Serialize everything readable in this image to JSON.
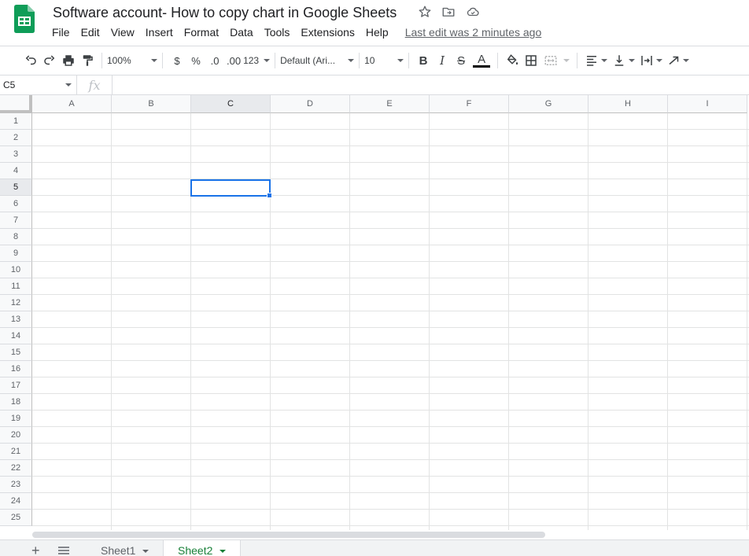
{
  "header": {
    "title": "Software account- How to copy chart in Google Sheets",
    "last_edit": "Last edit was 2 minutes ago",
    "menu": [
      "File",
      "Edit",
      "View",
      "Insert",
      "Format",
      "Data",
      "Tools",
      "Extensions",
      "Help"
    ]
  },
  "toolbar": {
    "zoom": "100%",
    "currency": "$",
    "percent": "%",
    "decrease_decimal": ".0",
    "increase_decimal": ".00",
    "more_formats": "123",
    "font": "Default (Ari...",
    "font_size": "10",
    "bold": "B",
    "italic": "I",
    "strike": "S",
    "text_color_label": "A",
    "text_color": "#000000"
  },
  "formula_bar": {
    "name_box": "C5",
    "fx": "fx",
    "value": ""
  },
  "grid": {
    "columns": [
      "A",
      "B",
      "C",
      "D",
      "E",
      "F",
      "G",
      "H",
      "I"
    ],
    "rows": [
      "1",
      "2",
      "3",
      "4",
      "5",
      "6",
      "7",
      "8",
      "9",
      "10",
      "11",
      "12",
      "13",
      "14",
      "15",
      "16",
      "17",
      "18",
      "19",
      "20",
      "21",
      "22",
      "23",
      "24",
      "25"
    ],
    "selected_column": "C",
    "selected_row": "5"
  },
  "sheets": {
    "tabs": [
      {
        "label": "Sheet1",
        "active": false
      },
      {
        "label": "Sheet2",
        "active": true
      }
    ]
  },
  "colors": {
    "accent": "#1a73e8",
    "active_tab": "#188038",
    "brand_green": "#0f9d58"
  }
}
